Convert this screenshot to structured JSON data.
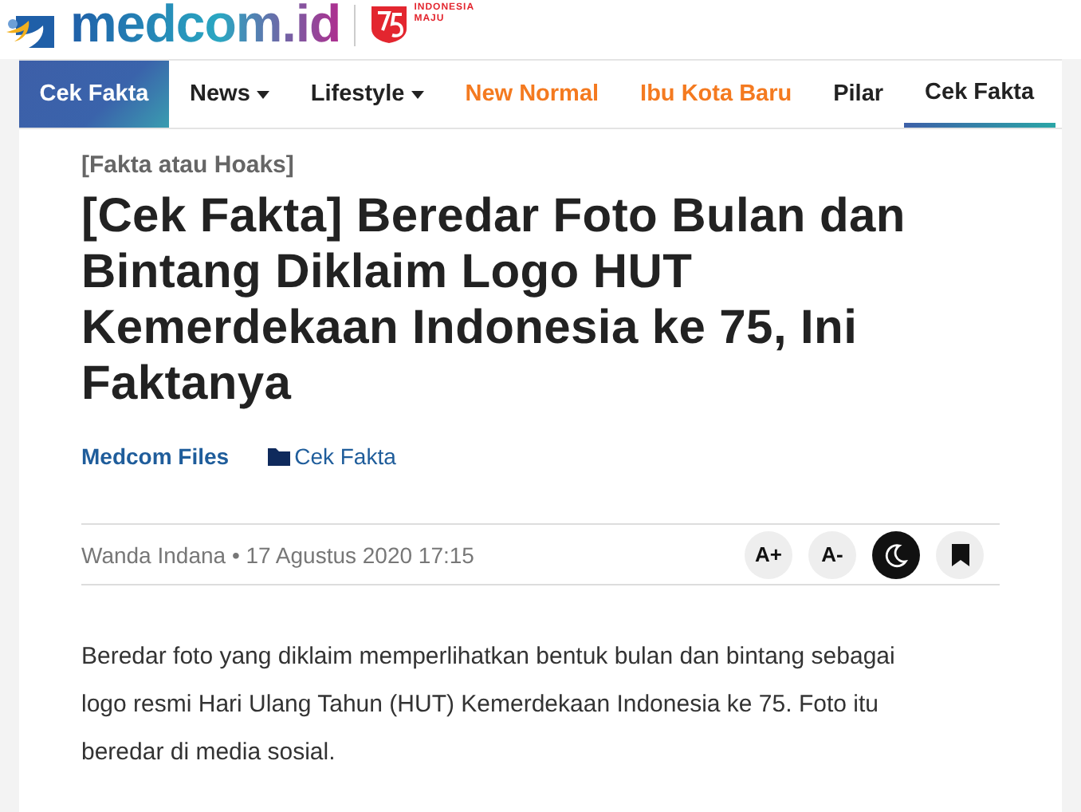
{
  "header": {
    "logo": "medcom.id",
    "badge_lines": [
      "INDONESIA",
      "MAJU"
    ]
  },
  "nav": [
    {
      "label": "Cek Fakta",
      "kind": "section",
      "selected": false,
      "dropdown": false,
      "highlight": false
    },
    {
      "label": "News",
      "kind": "link",
      "selected": false,
      "dropdown": true,
      "highlight": false
    },
    {
      "label": "Lifestyle",
      "kind": "link",
      "selected": false,
      "dropdown": true,
      "highlight": false
    },
    {
      "label": "New Normal",
      "kind": "link",
      "selected": false,
      "dropdown": false,
      "highlight": true
    },
    {
      "label": "Ibu Kota Baru",
      "kind": "link",
      "selected": false,
      "dropdown": false,
      "highlight": true
    },
    {
      "label": "Pilar",
      "kind": "link",
      "selected": false,
      "dropdown": false,
      "highlight": false
    },
    {
      "label": "Cek Fakta",
      "kind": "link",
      "selected": true,
      "dropdown": false,
      "highlight": false
    }
  ],
  "article": {
    "kicker": "[Fakta atau Hoaks]",
    "title": "[Cek Fakta] Beredar Foto Bulan dan Bintang Diklaim Logo HUT Kemerdekaan Indonesia ke 75, Ini Faktanya",
    "source": "Medcom Files",
    "category": "Cek Fakta",
    "byline": "Wanda Indana • 17 Agustus 2020 17:15",
    "tools": [
      {
        "kind": "text",
        "label": "A+"
      },
      {
        "kind": "text",
        "label": "A-"
      },
      {
        "kind": "dark-mode"
      },
      {
        "kind": "bookmark"
      }
    ],
    "body": "Beredar foto yang diklaim memperlihatkan bentuk bulan dan bintang sebagai logo resmi Hari Ulang Tahun (HUT) Kemerdekaan Indonesia ke 75. Foto itu beredar di media sosial."
  }
}
